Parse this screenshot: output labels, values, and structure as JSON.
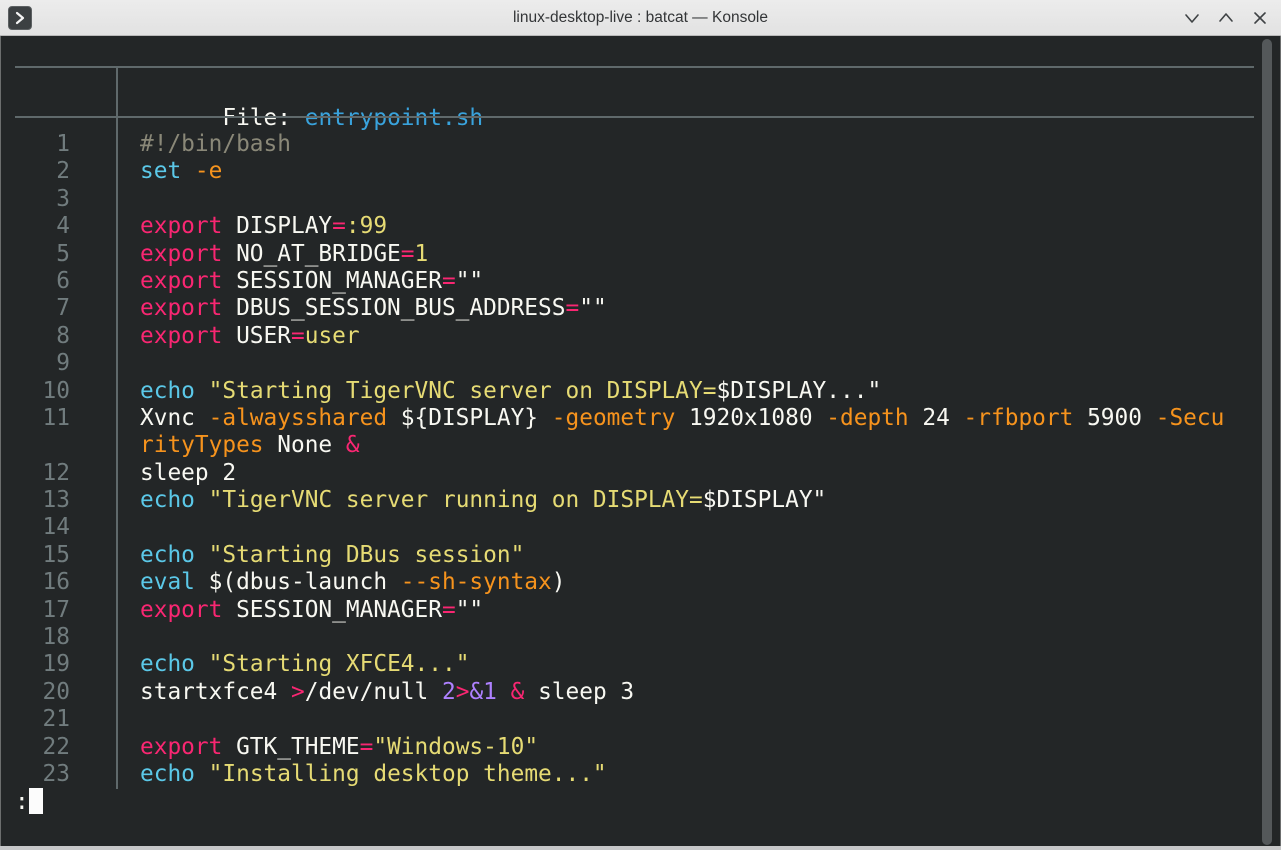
{
  "window": {
    "title": "linux-desktop-live : batcat — Konsole",
    "app_icon": "konsole-terminal-icon",
    "controls": [
      {
        "name": "minimize",
        "icon": "chevron-down-icon"
      },
      {
        "name": "maximize",
        "icon": "chevron-up-icon"
      },
      {
        "name": "close",
        "icon": "close-x-icon"
      }
    ]
  },
  "terminal": {
    "header": {
      "file_label": "File: ",
      "file_name": "entrypoint.sh"
    },
    "rows": [
      {
        "num": "1",
        "segs": [
          [
            "#!/bin/bash",
            "m"
          ]
        ]
      },
      {
        "num": "2",
        "segs": [
          [
            "set",
            "c"
          ],
          [
            " ",
            "w"
          ],
          [
            "-e",
            "o"
          ]
        ]
      },
      {
        "num": "3",
        "segs": []
      },
      {
        "num": "4",
        "segs": [
          [
            "export",
            "p"
          ],
          [
            " DISPLAY",
            "w"
          ],
          [
            "=",
            "p"
          ],
          [
            ":99",
            "y"
          ]
        ]
      },
      {
        "num": "5",
        "segs": [
          [
            "export",
            "p"
          ],
          [
            " NO_AT_BRIDGE",
            "w"
          ],
          [
            "=",
            "p"
          ],
          [
            "1",
            "y"
          ]
        ]
      },
      {
        "num": "6",
        "segs": [
          [
            "export",
            "p"
          ],
          [
            " SESSION_MANAGER",
            "w"
          ],
          [
            "=",
            "p"
          ],
          [
            "\"\"",
            "w"
          ]
        ]
      },
      {
        "num": "7",
        "segs": [
          [
            "export",
            "p"
          ],
          [
            " DBUS_SESSION_BUS_ADDRESS",
            "w"
          ],
          [
            "=",
            "p"
          ],
          [
            "\"\"",
            "w"
          ]
        ]
      },
      {
        "num": "8",
        "segs": [
          [
            "export",
            "p"
          ],
          [
            " USER",
            "w"
          ],
          [
            "=",
            "p"
          ],
          [
            "user",
            "y"
          ]
        ]
      },
      {
        "num": "9",
        "segs": []
      },
      {
        "num": "10",
        "segs": [
          [
            "echo",
            "c"
          ],
          [
            " ",
            "w"
          ],
          [
            "\"Starting TigerVNC server on DISPLAY=",
            "y"
          ],
          [
            "$DISPLAY...\"",
            "w"
          ]
        ]
      },
      {
        "num": "11",
        "segs": [
          [
            "Xvnc ",
            "w"
          ],
          [
            "-alwaysshared",
            "o"
          ],
          [
            " ${DISPLAY} ",
            "w"
          ],
          [
            "-geometry",
            "o"
          ],
          [
            " 1920x1080 ",
            "w"
          ],
          [
            "-depth",
            "o"
          ],
          [
            " 24 ",
            "w"
          ],
          [
            "-rfbport",
            "o"
          ],
          [
            " 5900 ",
            "w"
          ],
          [
            "-Secu",
            "o"
          ]
        ]
      },
      {
        "num": "",
        "segs": [
          [
            "rityTypes",
            "o"
          ],
          [
            " None ",
            "w"
          ],
          [
            "&",
            "p"
          ]
        ]
      },
      {
        "num": "12",
        "segs": [
          [
            "sleep 2",
            "w"
          ]
        ]
      },
      {
        "num": "13",
        "segs": [
          [
            "echo",
            "c"
          ],
          [
            " ",
            "w"
          ],
          [
            "\"TigerVNC server running on DISPLAY=",
            "y"
          ],
          [
            "$DISPLAY\"",
            "w"
          ]
        ]
      },
      {
        "num": "14",
        "segs": []
      },
      {
        "num": "15",
        "segs": [
          [
            "echo",
            "c"
          ],
          [
            " ",
            "w"
          ],
          [
            "\"Starting DBus session\"",
            "y"
          ]
        ]
      },
      {
        "num": "16",
        "segs": [
          [
            "eval",
            "c"
          ],
          [
            " $(dbus-launch ",
            "w"
          ],
          [
            "--sh-syntax",
            "o"
          ],
          [
            ")",
            "w"
          ]
        ]
      },
      {
        "num": "17",
        "segs": [
          [
            "export",
            "p"
          ],
          [
            " SESSION_MANAGER",
            "w"
          ],
          [
            "=",
            "p"
          ],
          [
            "\"\"",
            "w"
          ]
        ]
      },
      {
        "num": "18",
        "segs": []
      },
      {
        "num": "19",
        "segs": [
          [
            "echo",
            "c"
          ],
          [
            " ",
            "w"
          ],
          [
            "\"Starting XFCE4...\"",
            "y"
          ]
        ]
      },
      {
        "num": "20",
        "segs": [
          [
            "startxfce4 ",
            "w"
          ],
          [
            ">",
            "p"
          ],
          [
            "/dev/null ",
            "w"
          ],
          [
            "2",
            "u"
          ],
          [
            ">",
            "p"
          ],
          [
            "&1",
            "u"
          ],
          [
            " ",
            "w"
          ],
          [
            "&",
            "p"
          ],
          [
            " sleep 3",
            "w"
          ]
        ]
      },
      {
        "num": "21",
        "segs": []
      },
      {
        "num": "22",
        "segs": [
          [
            "export",
            "p"
          ],
          [
            " GTK_THEME",
            "w"
          ],
          [
            "=",
            "p"
          ],
          [
            "\"Windows-10\"",
            "y"
          ]
        ]
      },
      {
        "num": "23",
        "segs": [
          [
            "echo",
            "c"
          ],
          [
            " ",
            "w"
          ],
          [
            "\"Installing desktop theme...\"",
            "y"
          ]
        ]
      }
    ],
    "prompt": {
      "char": ":"
    }
  },
  "colors": {
    "background": "#232627",
    "foreground": "#f8f8f2",
    "pink": "#f92672",
    "orange": "#f6931d",
    "yellow": "#e6db74",
    "cyan": "#5bc8e8",
    "purple": "#ae81ff",
    "comment": "#8a8878",
    "line_number": "#717c7e",
    "grid": "#5f696b",
    "filename_blue": "#39a3dd",
    "cursor": "#fcfcfc",
    "scrollbar": "#54585a",
    "titlebar_bg": "#e2e2e2",
    "titlebar_text": "#333537"
  }
}
